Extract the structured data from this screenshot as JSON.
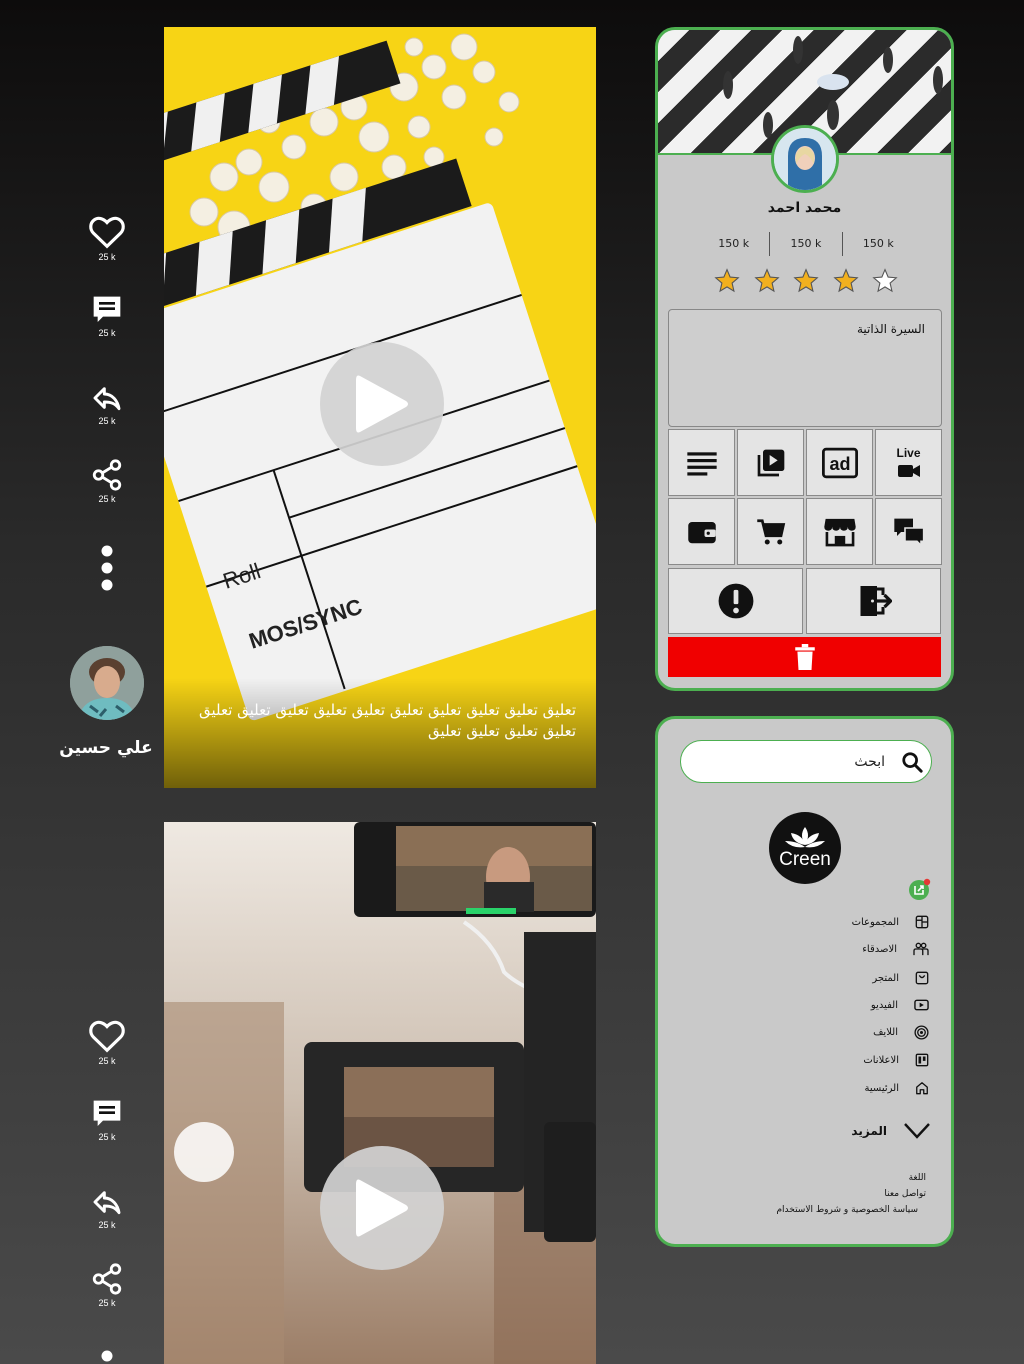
{
  "author": {
    "name": "علي حسين"
  },
  "video_1": {
    "caption": "تعليق تعليق تعليق تعليق تعليق تعليق تعليق تعليق تعليق تعليق تعليق تعليق تعليق تعليق",
    "clapper_text_1": "Roll",
    "clapper_text_2": "MOS/SYNC",
    "actions": {
      "likes": "25 k",
      "comments": "25 k",
      "reposts": "25 k",
      "shares": "25 k"
    }
  },
  "video_2": {
    "actions": {
      "likes": "25 k",
      "comments": "25 k",
      "reposts": "25 k",
      "shares": "25 k"
    }
  },
  "profile": {
    "name": "محمد احمد",
    "stats": [
      "150 k",
      "150 k",
      "150 k"
    ],
    "rating": 4,
    "rating_max": 5,
    "bio_label": "السيرة الذاتية",
    "live_label": "Live"
  },
  "menu": {
    "search_placeholder": "ابحث",
    "logo_text": "Creen",
    "items": [
      {
        "label": "المجموعات",
        "icon": "groups-icon"
      },
      {
        "label": "الاصدقاء",
        "icon": "friends-icon"
      },
      {
        "label": "المتجر",
        "icon": "store-icon"
      },
      {
        "label": "الفيديو",
        "icon": "video-icon"
      },
      {
        "label": "اللايف",
        "icon": "live-icon"
      },
      {
        "label": "الاعلانات",
        "icon": "ads-icon"
      },
      {
        "label": "الرئيسية",
        "icon": "home-icon"
      }
    ],
    "more_label": "المزيد",
    "footer": {
      "language": "اللغة",
      "contact": "تواصل معنا",
      "privacy": "سياسة الخصوصية و شروط الاستخدام"
    }
  },
  "colors": {
    "accent": "#4caf50",
    "danger": "#f00000",
    "star": "#f2b01e"
  }
}
